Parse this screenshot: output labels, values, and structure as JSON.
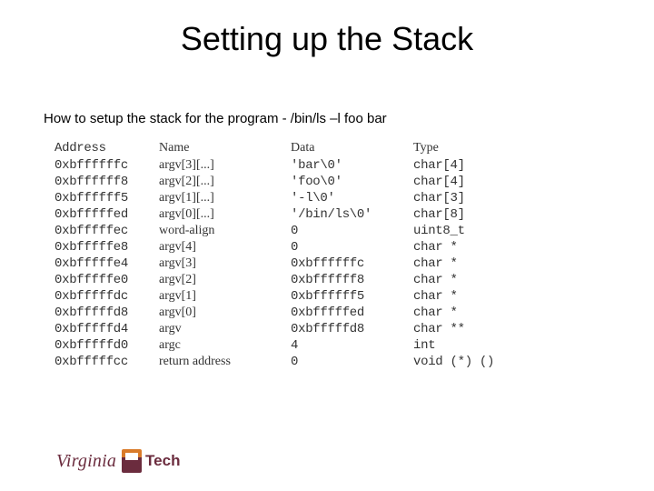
{
  "title": "Setting up the Stack",
  "subtitle": "How to setup the stack for the program - /bin/ls –l foo bar",
  "headers": {
    "address": "Address",
    "name": "Name",
    "data": "Data",
    "type": "Type"
  },
  "rows": [
    {
      "address": "0xbffffffc",
      "name": "argv[3][...]",
      "data": "'bar\\0'",
      "type": "char[4]"
    },
    {
      "address": "0xbffffff8",
      "name": "argv[2][...]",
      "data": "'foo\\0'",
      "type": "char[4]"
    },
    {
      "address": "0xbffffff5",
      "name": "argv[1][...]",
      "data": "'-l\\0'",
      "type": "char[3]"
    },
    {
      "address": "0xbfffffed",
      "name": "argv[0][...]",
      "data": "'/bin/ls\\0'",
      "type": "char[8]"
    },
    {
      "address": "0xbfffffec",
      "name": "word-align",
      "data": "0",
      "type": "uint8_t"
    },
    {
      "address": "0xbfffffe8",
      "name": "argv[4]",
      "data": "0",
      "type": "char *"
    },
    {
      "address": "0xbfffffe4",
      "name": "argv[3]",
      "data": "0xbffffffc",
      "type": "char *"
    },
    {
      "address": "0xbfffffe0",
      "name": "argv[2]",
      "data": "0xbffffff8",
      "type": "char *"
    },
    {
      "address": "0xbfffffdc",
      "name": "argv[1]",
      "data": "0xbffffff5",
      "type": "char *"
    },
    {
      "address": "0xbfffffd8",
      "name": "argv[0]",
      "data": "0xbfffffed",
      "type": "char *"
    },
    {
      "address": "0xbfffffd4",
      "name": "argv",
      "data": "0xbfffffd8",
      "type": "char **"
    },
    {
      "address": "0xbfffffd0",
      "name": "argc",
      "data": "4",
      "type": "int"
    },
    {
      "address": "0xbfffffcc",
      "name": "return address",
      "data": "0",
      "type": "void (*) ()"
    }
  ],
  "footer": {
    "virginia": "Virginia",
    "tech": "Tech"
  }
}
